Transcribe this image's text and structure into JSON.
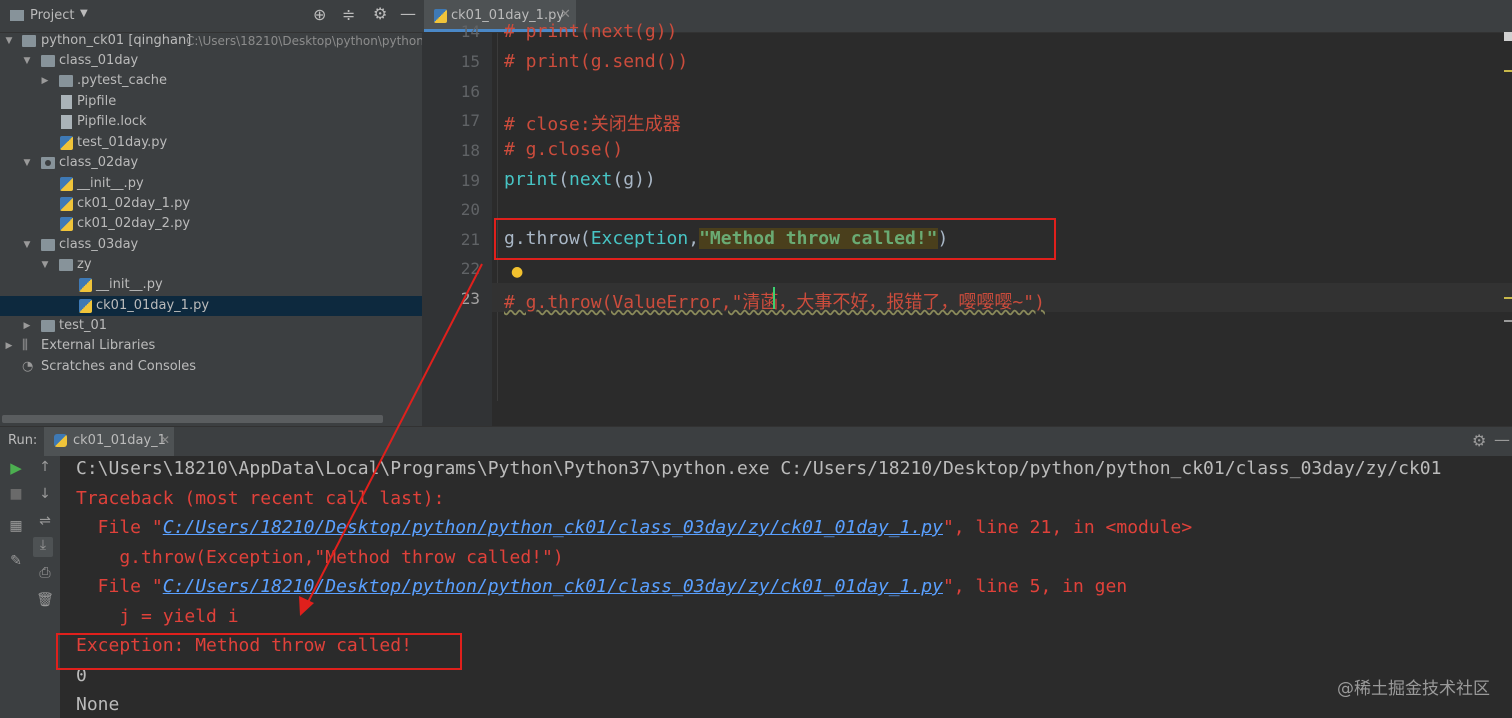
{
  "project": {
    "header": "Project",
    "tree": [
      {
        "label": "python_ck01 [qinghan]",
        "path": "C:\\Users\\18210\\Desktop\\python\\python"
      },
      {
        "label": "class_01day"
      },
      {
        "label": ".pytest_cache"
      },
      {
        "label": "Pipfile"
      },
      {
        "label": "Pipfile.lock"
      },
      {
        "label": "test_01day.py"
      },
      {
        "label": "class_02day"
      },
      {
        "label": "__init__.py"
      },
      {
        "label": "ck01_02day_1.py"
      },
      {
        "label": "ck01_02day_2.py"
      },
      {
        "label": "class_03day"
      },
      {
        "label": "zy"
      },
      {
        "label": "__init__.py"
      },
      {
        "label": "ck01_01day_1.py"
      },
      {
        "label": "test_01"
      },
      {
        "label": "External Libraries"
      },
      {
        "label": "Scratches and Consoles"
      }
    ]
  },
  "editor": {
    "tab_label": "ck01_01day_1.py",
    "line_numbers": [
      "14",
      "15",
      "16",
      "17",
      "18",
      "19",
      "20",
      "21",
      "22",
      "23"
    ],
    "lines": {
      "l14": "# print(next(g))",
      "l15": "# print(g.send())",
      "l17": "# close:关闭生成器",
      "l18": "# g.close()",
      "l19_print": "print",
      "l19_p1": "(",
      "l19_next": "next",
      "l19_rest": "(g))",
      "l21_a": "g.throw(",
      "l21_exc": "Exception",
      "l21_comma": ",",
      "l21_str": "\"Method throw called!\"",
      "l21_end": ")",
      "l23": "# g.throw(ValueError,\"清菡，大事不好，报错了，嘤嘤嘤~\")"
    }
  },
  "run": {
    "label": "Run:",
    "tab_label": "ck01_01day_1",
    "output": {
      "cmd": "C:\\Users\\18210\\AppData\\Local\\Programs\\Python\\Python37\\python.exe C:/Users/18210/Desktop/python/python_ck01/class_03day/zy/ck01",
      "traceback": "Traceback (most recent call last):",
      "file1_pre": "  File \"",
      "file1_link": "C:/Users/18210/Desktop/python/python_ck01/class_03day/zy/ck01_01day_1.py",
      "file1_post": "\", line 21, in <module>",
      "code1": "    g.throw(Exception,\"Method throw called!\")",
      "file2_pre": "  File \"",
      "file2_link": "C:/Users/18210/Desktop/python/python_ck01/class_03day/zy/ck01_01day_1.py",
      "file2_post": "\", line 5, in gen",
      "code2": "    j = yield i",
      "exception": "Exception: Method throw called!",
      "out0": "0",
      "out_none": "None"
    }
  },
  "watermark": "@稀土掘金技术社区",
  "colors": {
    "annotation_red": "#e0201c",
    "link_blue": "#5aa0ff",
    "error_red": "#e0413a"
  }
}
